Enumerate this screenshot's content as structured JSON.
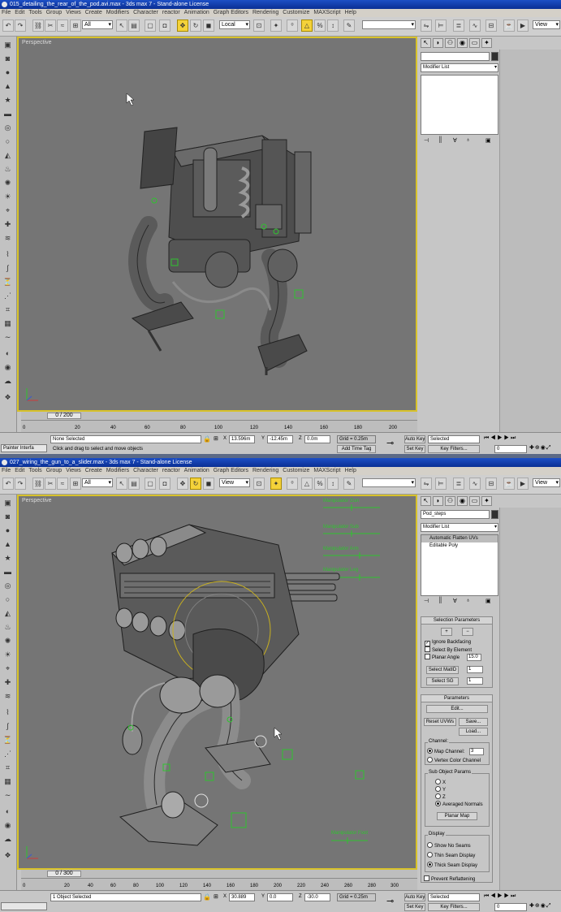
{
  "menu_items": [
    "File",
    "Edit",
    "Tools",
    "Group",
    "Views",
    "Create",
    "Modifiers",
    "Character",
    "reactor",
    "Animation",
    "Graph Editors",
    "Rendering",
    "Customize",
    "MAXScript",
    "Help"
  ],
  "window1": {
    "title": "015_detailing_the_rear_of_the_pod.avi.max - 3ds max 7 - Stand-alone License",
    "selection_filter": "All",
    "ref_coord": "Local",
    "named_sel": "View",
    "viewport_label": "Perspective",
    "modifier_list": "Modifier List",
    "time_slider": "0 / 200",
    "ruler_ticks": [
      "0",
      "20",
      "40",
      "60",
      "80",
      "100",
      "120",
      "140",
      "160",
      "180",
      "200"
    ],
    "status_left": "Painter Interfa",
    "selection_status": "None Selected",
    "prompt": "Click and drag to select and move objects",
    "x_label": "X",
    "x_val": "13.596m",
    "y_label": "Y",
    "y_val": "-12.45m",
    "z_label": "Z",
    "z_val": "0.0m",
    "grid": "Grid = 0.25m",
    "add_time_tag": "Add Time Tag",
    "auto_key": "Auto Key",
    "set_key": "Set Key",
    "key_mode": "Selected",
    "key_filters": "Key Filters...",
    "frame": "0"
  },
  "window2": {
    "title": "027_wiring_the_gun_to_a_slider.max - 3ds max 7 - Stand-alone License",
    "selection_filter": "All",
    "ref_coord": "View",
    "named_sel": "View",
    "viewport_label": "Perspective",
    "object_name": "Pod_steps",
    "modifier_list": "Modifier List",
    "stack": [
      "Automatic Flatten UVs",
      "Editable Poly"
    ],
    "time_slider": "0 / 300",
    "ruler_ticks": [
      "0",
      "20",
      "40",
      "60",
      "80",
      "100",
      "120",
      "140",
      "160",
      "180",
      "200",
      "220",
      "240",
      "260",
      "280",
      "300"
    ],
    "selection_status": "1 Object Selected",
    "x_label": "X",
    "x_val": "30.889",
    "y_label": "Y",
    "y_val": "0.0",
    "z_label": "Z",
    "z_val": "-30.0",
    "grid": "Grid = 0.25m",
    "auto_key": "Auto Key",
    "set_key": "Set Key",
    "key_mode": "Selected",
    "key_filters": "Key Filters...",
    "frame": "0",
    "selection_params": {
      "title": "Selection Parameters",
      "ignore_backfacing": "Ignore Backfacing",
      "select_by_element": "Select By Element",
      "planar_angle": "Planar Angle",
      "planar_angle_val": "15.0",
      "select_matid": "Select MatID",
      "select_matid_val": "1",
      "select_sg": "Select SG",
      "select_sg_val": "1"
    },
    "parameters": {
      "title": "Parameters",
      "edit": "Edit...",
      "reset_uvws": "Reset UVWs",
      "save": "Save...",
      "load": "Load...",
      "channel_label": "Channel:",
      "map_channel": "Map Channel:",
      "map_channel_val": "3",
      "vertex_color_channel": "Vertex Color Channel",
      "sub_object_params": "Sub Object Params",
      "x": "X",
      "y": "Y",
      "z": "Z",
      "averaged_normals": "Averaged Normals",
      "planar_map": "Planar Map",
      "display_label": "Display",
      "show_no_seams": "Show No Seams",
      "thin_seam": "Thin Seam Display",
      "thick_seam": "Thick Seam Display",
      "prevent_reflattening": "Prevent Reflattening"
    },
    "green_labels": [
      "Manipulator Gun",
      "Manipulator Sub",
      "Manipulator Arm",
      "Manipulator Leg",
      "Manipulator Foot"
    ]
  }
}
